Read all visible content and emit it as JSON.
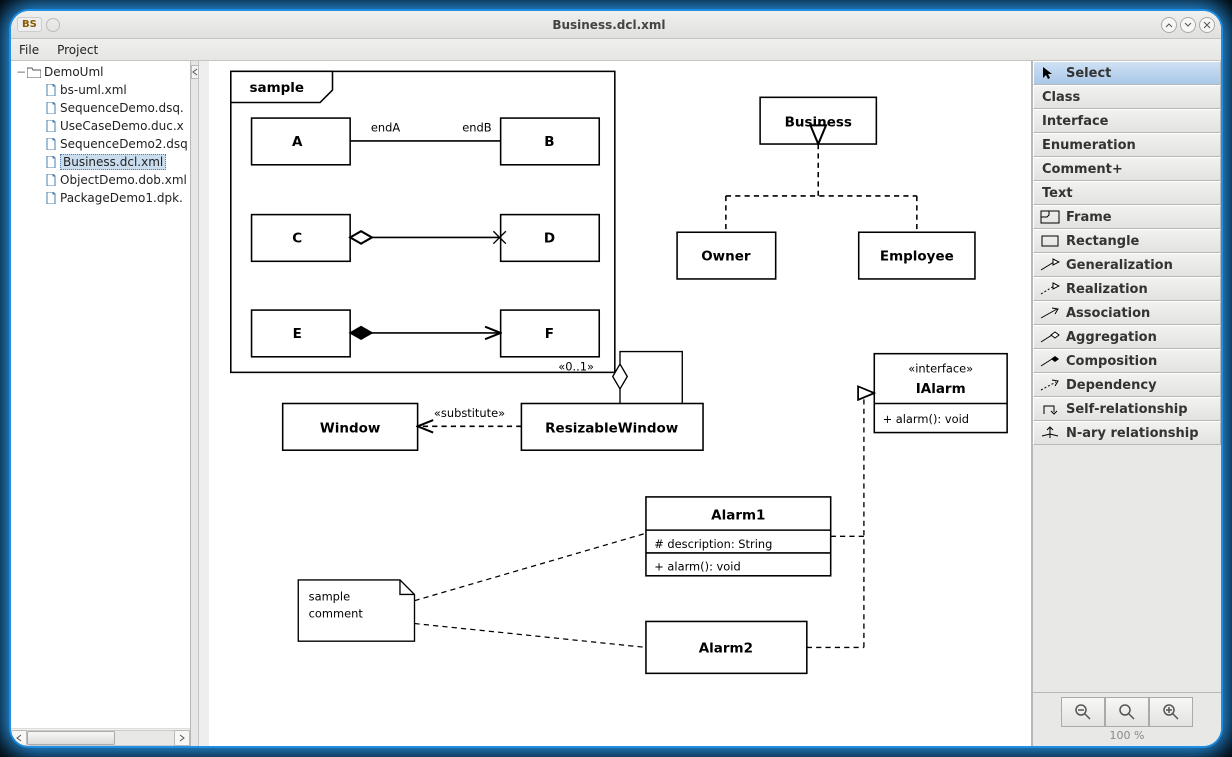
{
  "title": "Business.dcl.xml",
  "badge": "BS",
  "menu": {
    "file": "File",
    "project": "Project"
  },
  "tree": {
    "root": "DemoUml",
    "items": [
      "bs-uml.xml",
      "SequenceDemo.dsq.",
      "UseCaseDemo.duc.x",
      "SequenceDemo2.dsq",
      "Business.dcl.xml",
      "ObjectDemo.dob.xml",
      "PackageDemo1.dpk."
    ],
    "selectedIndex": 4
  },
  "palette": {
    "select": "Select",
    "class": "Class",
    "interface": "Interface",
    "enumeration": "Enumeration",
    "comment": "Comment+",
    "text": "Text",
    "frame": "Frame",
    "rectangle": "Rectangle",
    "generalization": "Generalization",
    "realization": "Realization",
    "association": "Association",
    "aggregation": "Aggregation",
    "composition": "Composition",
    "dependency": "Dependency",
    "selfrel": "Self-relationship",
    "nary": "N-ary relationship"
  },
  "zoom": {
    "label": "100 %"
  },
  "diagram": {
    "frame": "sample",
    "classes": {
      "A": "A",
      "B": "B",
      "C": "C",
      "D": "D",
      "E": "E",
      "F": "F",
      "Business": "Business",
      "Owner": "Owner",
      "Employee": "Employee",
      "Window": "Window",
      "ResizableWindow": "ResizableWindow",
      "Alarm1": "Alarm1",
      "Alarm2": "Alarm2"
    },
    "interface": {
      "stereo": "«interface»",
      "name": "IAlarm",
      "op": "+ alarm(): void"
    },
    "alarm1": {
      "attr": "# description: String",
      "op": "+ alarm(): void"
    },
    "labels": {
      "endA": "endA",
      "endB": "endB",
      "substitute": "«substitute»",
      "mult": "«0..1»"
    },
    "comment": {
      "l1": "sample",
      "l2": "comment"
    }
  }
}
